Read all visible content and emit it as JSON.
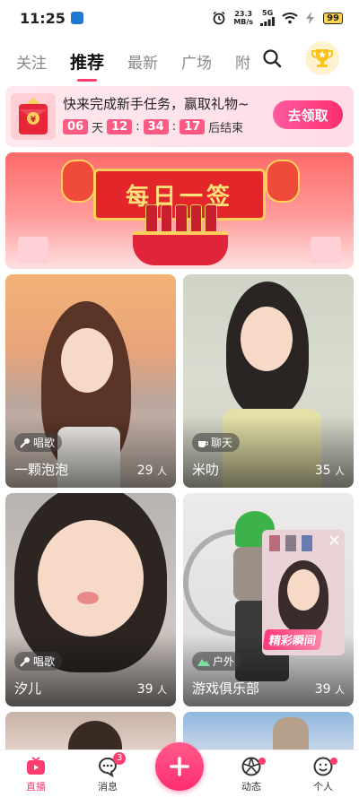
{
  "status_bar": {
    "time": "11:25",
    "net_speed": "23.3",
    "net_unit": "MB/s",
    "signal": "5G",
    "battery": "99"
  },
  "tabs": [
    {
      "label": "关注"
    },
    {
      "label": "推荐"
    },
    {
      "label": "最新"
    },
    {
      "label": "广场"
    },
    {
      "label": "附"
    }
  ],
  "task_banner": {
    "title": "快来完成新手任务，赢取礼物~",
    "days": "06",
    "day_unit": "天",
    "hours": "12",
    "minutes": "34",
    "seconds": "17",
    "suffix": "后结束",
    "claim_label": "去领取"
  },
  "daily_banner": {
    "title": "每日一签"
  },
  "rooms": [
    {
      "category": "唱歌",
      "name": "一颗泡泡",
      "count": "29",
      "unit": "人"
    },
    {
      "category": "聊天",
      "name": "米叻",
      "count": "35",
      "unit": "人"
    },
    {
      "category": "唱歌",
      "name": "汐儿",
      "count": "39",
      "unit": "人"
    },
    {
      "category": "户外",
      "name": "游戏俱乐部",
      "count": "39",
      "unit": "人"
    }
  ],
  "mini_window": {
    "label": "精彩瞬间"
  },
  "bottom_nav": {
    "live": "直播",
    "messages": "消息",
    "messages_badge": "3",
    "moments": "动态",
    "me": "个人"
  },
  "colors": {
    "accent": "#ff3d6e",
    "countdown": "#ff5a84"
  }
}
